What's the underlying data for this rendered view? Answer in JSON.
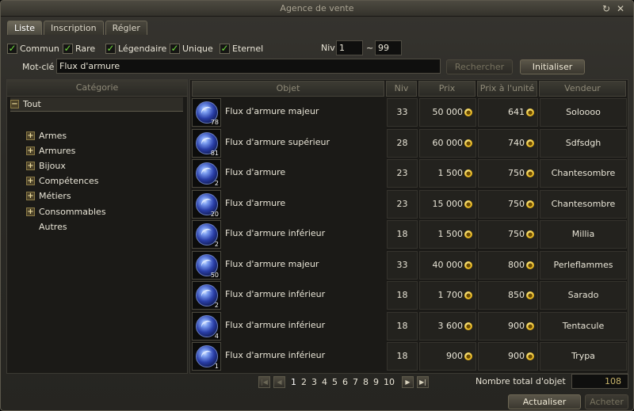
{
  "window": {
    "title": "Agence de vente"
  },
  "tabs": [
    {
      "label": "Liste",
      "active": true
    },
    {
      "label": "Inscription",
      "active": false
    },
    {
      "label": "Régler",
      "active": false
    }
  ],
  "filters": {
    "checkboxes": [
      {
        "label": "Commun",
        "checked": true
      },
      {
        "label": "Rare",
        "checked": true
      },
      {
        "label": "Légendaire",
        "checked": true
      },
      {
        "label": "Unique",
        "checked": true
      },
      {
        "label": "Eternel",
        "checked": true
      }
    ],
    "niv_label": "Niv",
    "niv_min": "1",
    "niv_sep": "~",
    "niv_max": "99",
    "keyword_label": "Mot-clé",
    "keyword_value": "Flux d'armure",
    "search_label": "Rechercher",
    "reset_label": "Initialiser"
  },
  "categories": {
    "header": "Catégorie",
    "root": "Tout",
    "items": [
      "Armes",
      "Armures",
      "Bijoux",
      "Compétences",
      "Métiers",
      "Consommables",
      "Autres"
    ]
  },
  "columns": {
    "item": "Objet",
    "niv": "Niv",
    "price": "Prix",
    "unit": "Prix à l'unité",
    "seller": "Vendeur"
  },
  "rows": [
    {
      "qty": "78",
      "name": "Flux d'armure majeur",
      "niv": "33",
      "price": "50 000",
      "unit": "641",
      "seller": "Soloooo"
    },
    {
      "qty": "81",
      "name": "Flux d'armure supérieur",
      "niv": "28",
      "price": "60 000",
      "unit": "740",
      "seller": "Sdfsdgh"
    },
    {
      "qty": "2",
      "name": "Flux d'armure",
      "niv": "23",
      "price": "1 500",
      "unit": "750",
      "seller": "Chantesombre"
    },
    {
      "qty": "20",
      "name": "Flux d'armure",
      "niv": "23",
      "price": "15 000",
      "unit": "750",
      "seller": "Chantesombre"
    },
    {
      "qty": "2",
      "name": "Flux d'armure inférieur",
      "niv": "18",
      "price": "1 500",
      "unit": "750",
      "seller": "Millia"
    },
    {
      "qty": "50",
      "name": "Flux d'armure majeur",
      "niv": "33",
      "price": "40 000",
      "unit": "800",
      "seller": "Perleflammes"
    },
    {
      "qty": "2",
      "name": "Flux d'armure inférieur",
      "niv": "18",
      "price": "1 700",
      "unit": "850",
      "seller": "Sarado"
    },
    {
      "qty": "4",
      "name": "Flux d'armure inférieur",
      "niv": "18",
      "price": "3 600",
      "unit": "900",
      "seller": "Tentacule"
    },
    {
      "qty": "1",
      "name": "Flux d'armure inférieur",
      "niv": "18",
      "price": "900",
      "unit": "900",
      "seller": "Trypa"
    }
  ],
  "pagination": {
    "pages": [
      "1",
      "2",
      "3",
      "4",
      "5",
      "6",
      "7",
      "8",
      "9",
      "10"
    ],
    "current": "1",
    "total_label": "Nombre total d'objet",
    "total_value": "108"
  },
  "footer": {
    "refresh_label": "Actualiser",
    "buy_label": "Acheter"
  },
  "colors": {
    "check": "#6fdc3c",
    "coin": "#e8b923",
    "item_orb": "#2a3fa8"
  }
}
